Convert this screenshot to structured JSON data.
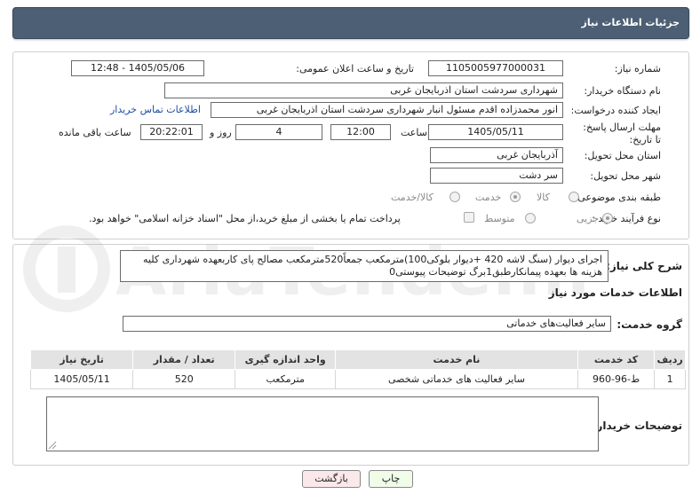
{
  "header": {
    "title": "جزئیات اطلاعات نیاز"
  },
  "form": {
    "need_number": {
      "label": "شماره نیاز:",
      "value": "1105005977000031"
    },
    "announce_datetime": {
      "label": "تاریخ و ساعت اعلان عمومی:",
      "value": "1405/05/06 - 12:48"
    },
    "buyer_org": {
      "label": "نام دستگاه خریدار:",
      "value": "شهرداری سردشت استان اذربایجان غربی"
    },
    "creator": {
      "label": "ایجاد کننده درخواست:",
      "value": "انور محمدزاده اقدم مسئول انبار شهرداری سردشت استان اذربایجان غربی",
      "contact_link": "اطلاعات تماس خریدار"
    },
    "deadline": {
      "label": "مهلت ارسال پاسخ: تا تاریخ:",
      "date": "1405/05/11",
      "time_label": "ساعت",
      "time": "12:00",
      "days": "4",
      "days_label": "روز و",
      "remaining_time": "20:22:01",
      "remaining_label": "ساعت باقی مانده"
    },
    "delivery_province": {
      "label": "استان محل تحویل:",
      "value": "آذربایجان غربی"
    },
    "delivery_city": {
      "label": "شهر محل تحویل:",
      "value": "سر دشت"
    },
    "category": {
      "label": "طبقه بندی موضوعی:",
      "options": [
        "کالا",
        "خدمت",
        "کالا/خدمت"
      ],
      "selected": "خدمت"
    },
    "purchase_type": {
      "label": "نوع فرآیند خرید :",
      "options": [
        "جزیی",
        "متوسط"
      ],
      "selected": "جزیی",
      "note": "پرداخت تمام یا بخشی از مبلغ خرید،از محل \"اسناد خزانه اسلامی\" خواهد بود."
    }
  },
  "general_desc": {
    "label": "شرح کلی نیاز:",
    "value": "اجرای دیوار (سنگ لاشه 420 +دیوار بلوکی100)مترمکعب جمعاً520مترمکعب مصالح پای کاربعهده شهرداری کلیه هزینه ها بعهده پیمانکارطبق1برگ توضیحات پیوستی0"
  },
  "services_section": {
    "title": "اطلاعات خدمات مورد نیاز",
    "group_label": "گروه خدمت:",
    "group_value": "سایر فعالیت‌های خدماتی",
    "table": {
      "headers": [
        "ردیف",
        "کد خدمت",
        "نام خدمت",
        "واحد اندازه گیری",
        "تعداد / مقدار",
        "تاریخ نیاز"
      ],
      "rows": [
        [
          "1",
          "ط-96-960",
          "سایر فعالیت های خدماتی شخصی",
          "مترمکعب",
          "520",
          "1405/05/11"
        ]
      ]
    }
  },
  "buyer_notes": {
    "label": "توضیحات خریدار:",
    "value": ""
  },
  "buttons": {
    "print": "چاپ",
    "back": "بازگشت"
  },
  "watermark": {
    "text": "AriaTender.net"
  },
  "colors": {
    "header_bg": "#4d5f74",
    "link": "#1f4ea3",
    "print_bg": "#f0fbe8",
    "back_bg": "#fbe8ea"
  }
}
